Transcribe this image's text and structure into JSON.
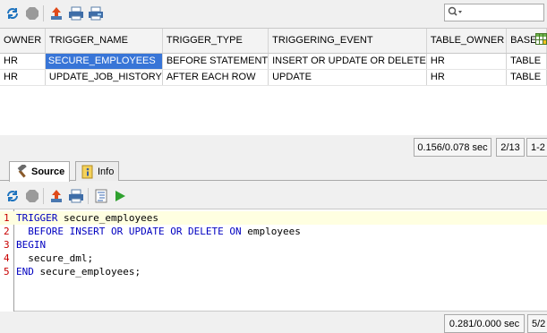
{
  "toolbar": {
    "buttons": [
      "refresh-icon",
      "stop-icon",
      "export-icon",
      "print-icon",
      "print-setup-icon"
    ],
    "search": {
      "value": "",
      "placeholder": ""
    }
  },
  "grid": {
    "columns": [
      "OWNER",
      "TRIGGER_NAME",
      "TRIGGER_TYPE",
      "TRIGGERING_EVENT",
      "TABLE_OWNER",
      "BASE"
    ],
    "rows": [
      [
        "HR",
        "SECURE_EMPLOYEES",
        "BEFORE STATEMENT",
        "INSERT OR UPDATE OR DELETE",
        "HR",
        "TABLE"
      ],
      [
        "HR",
        "UPDATE_JOB_HISTORY",
        "AFTER EACH ROW",
        "UPDATE",
        "HR",
        "TABLE"
      ]
    ],
    "selected_cell": "SECURE_EMPLOYEES"
  },
  "grid_status": {
    "timing": "0.156/0.078 sec",
    "position": "2/13",
    "range": "1-2"
  },
  "tabs": [
    {
      "label": "Source",
      "icon": "hammer-icon",
      "active": true
    },
    {
      "label": "Info",
      "icon": "info-icon",
      "active": false
    }
  ],
  "editor": {
    "lines": [
      {
        "num": "1",
        "parts": [
          [
            "kw",
            "TRIGGER"
          ],
          [
            "",
            " secure_employees"
          ]
        ]
      },
      {
        "num": "2",
        "parts": [
          [
            "",
            "  "
          ],
          [
            "kw",
            "BEFORE INSERT OR UPDATE OR DELETE ON"
          ],
          [
            "",
            " employees"
          ]
        ]
      },
      {
        "num": "3",
        "parts": [
          [
            "kw",
            "BEGIN"
          ]
        ]
      },
      {
        "num": "4",
        "parts": [
          [
            "",
            "  secure_dml;"
          ]
        ]
      },
      {
        "num": "5",
        "parts": [
          [
            "kw",
            "END"
          ],
          [
            "",
            " secure_employees;"
          ]
        ]
      }
    ]
  },
  "editor_status": {
    "timing": "0.281/0.000 sec",
    "position": "5/2"
  },
  "colors": {
    "selection": "#3875d7",
    "keyword": "#0000c0",
    "line_number": "#c80000",
    "current_line": "#ffffe1"
  }
}
